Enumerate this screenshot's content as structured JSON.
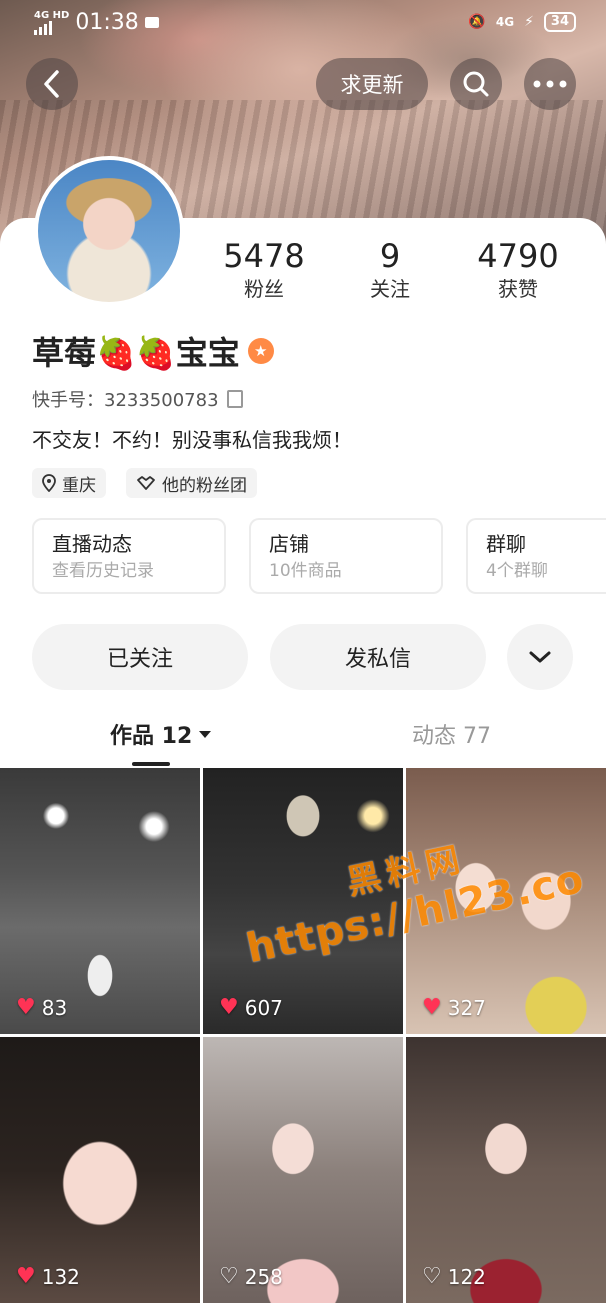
{
  "status_bar": {
    "network": "4G HD",
    "time": "01:38",
    "signal_4g": "4G",
    "battery": "34"
  },
  "header": {
    "update_label": "求更新"
  },
  "profile": {
    "name": "草莓🍓🍓宝宝",
    "stats": [
      {
        "value": "5478",
        "label": "粉丝"
      },
      {
        "value": "9",
        "label": "关注"
      },
      {
        "value": "4790",
        "label": "获赞"
      }
    ],
    "kuaishou_id_label": "快手号：",
    "kuaishou_id": "3233500783",
    "bio": "不交友！不约！别没事私信我我烦！",
    "location": "重庆",
    "fan_group": "他的粉丝团"
  },
  "info_cards": [
    {
      "title": "直播动态",
      "subtitle": "查看历史记录"
    },
    {
      "title": "店铺",
      "subtitle": "10件商品"
    },
    {
      "title": "群聊",
      "subtitle": "4个群聊"
    }
  ],
  "actions": {
    "followed": "已关注",
    "message": "发私信"
  },
  "tabs": [
    {
      "label": "作品 12",
      "active": true
    },
    {
      "label": "动态 77",
      "active": false
    }
  ],
  "videos": [
    {
      "likes": "83"
    },
    {
      "likes": "607"
    },
    {
      "likes": "327"
    },
    {
      "likes": "132"
    },
    {
      "likes": "258"
    },
    {
      "likes": "122"
    }
  ],
  "watermark": {
    "line1": "黑料网",
    "line2": "https://hl23.co"
  },
  "colors": {
    "accent": "#ff8a45",
    "heart": "#ff3355",
    "watermark": "#ff8a00"
  }
}
